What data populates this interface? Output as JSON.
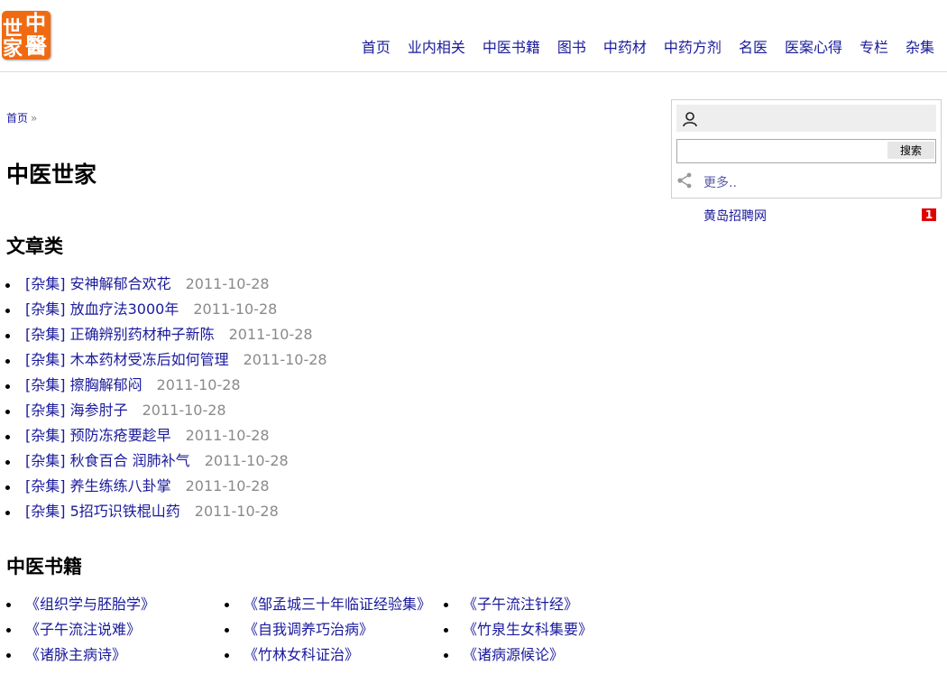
{
  "logo": {
    "chars": [
      "中",
      "世",
      "家",
      "醫"
    ]
  },
  "nav": {
    "items": [
      "首页",
      "业内相关",
      "中医书籍",
      "图书",
      "中药材",
      "中药方剂",
      "名医",
      "医案心得",
      "专栏",
      "杂集"
    ]
  },
  "breadcrumb": {
    "home": "首页",
    "separator": "»"
  },
  "page_title": "中医世家",
  "articles": {
    "heading": "文章类",
    "items": [
      {
        "category": "[杂集]",
        "title": "安神解郁合欢花",
        "date": "2011-10-28"
      },
      {
        "category": "[杂集]",
        "title": "放血疗法3000年",
        "date": "2011-10-28"
      },
      {
        "category": "[杂集]",
        "title": "正确辨别药材种子新陈",
        "date": "2011-10-28"
      },
      {
        "category": "[杂集]",
        "title": "木本药材受冻后如何管理",
        "date": "2011-10-28"
      },
      {
        "category": "[杂集]",
        "title": "擦胸解郁闷",
        "date": "2011-10-28"
      },
      {
        "category": "[杂集]",
        "title": "海参肘子",
        "date": "2011-10-28"
      },
      {
        "category": "[杂集]",
        "title": "预防冻疮要趁早",
        "date": "2011-10-28"
      },
      {
        "category": "[杂集]",
        "title": "秋食百合 润肺补气",
        "date": "2011-10-28"
      },
      {
        "category": "[杂集]",
        "title": "养生练练八卦掌",
        "date": "2011-10-28"
      },
      {
        "category": "[杂集]",
        "title": "5招巧识铁棍山药",
        "date": "2011-10-28"
      }
    ]
  },
  "books": {
    "heading": "中医书籍",
    "columns": [
      [
        "《组织学与胚胎学》",
        "《子午流注说难》",
        "《诸脉主病诗》"
      ],
      [
        "《邹孟城三十年临证经验集》",
        "《自我调养巧治病》",
        "《竹林女科证治》"
      ],
      [
        "《子午流注针经》",
        "《竹泉生女科集要》",
        "《诸病源候论》"
      ]
    ]
  },
  "sidebar": {
    "search_placeholder": "",
    "search_button": "搜索",
    "more_label": "更多..",
    "recruit_link": "黄岛招聘网",
    "badge": "1"
  },
  "colors": {
    "accent": "#f06a12",
    "link": "#1a1a9c",
    "date": "#8a8a8a",
    "badge": "#e00000"
  },
  "icons": {
    "user": "user-icon",
    "share": "share-icon"
  }
}
